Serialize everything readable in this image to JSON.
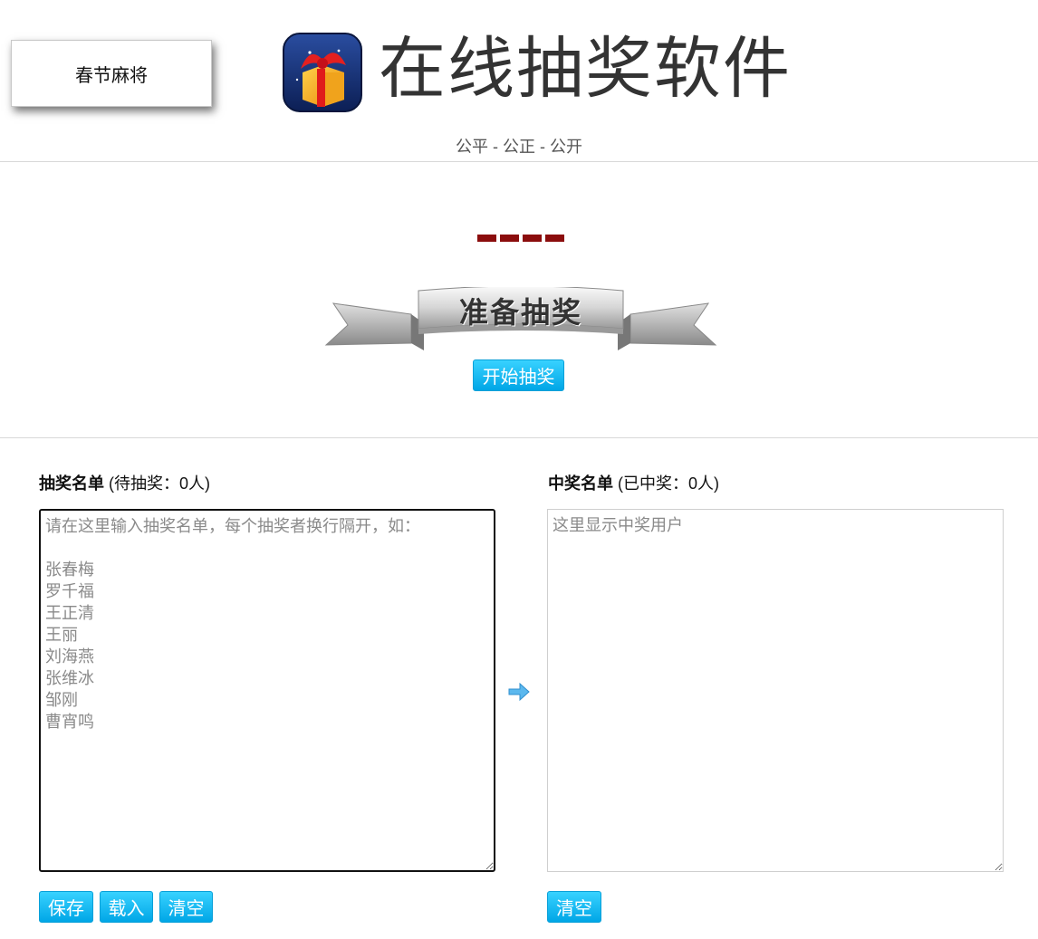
{
  "header": {
    "side_tag": "春节麻将",
    "title": "在线抽奖软件",
    "subtitle": "公平 - 公正 - 公开",
    "icon": "gift-box-icon"
  },
  "draw": {
    "banner_text": "准备抽奖",
    "start_button": "开始抽奖",
    "placeholder_dashes": 4,
    "dash_color": "#8b0d0d"
  },
  "left_panel": {
    "title": "抽奖名单",
    "count_text": "(待抽奖：0人)",
    "placeholder": "请在这里输入抽奖名单，每个抽奖者换行隔开，如：\n\n张春梅\n罗千福\n王正清\n王丽\n刘海燕\n张维冰\n邹刚\n曹宵鸣",
    "value": "",
    "buttons": {
      "save": "保存",
      "load": "载入",
      "clear": "清空"
    }
  },
  "transfer_icon": "arrow-right-icon",
  "right_panel": {
    "title": "中奖名单",
    "count_text": "(已中奖：0人)",
    "placeholder": "这里显示中奖用户",
    "value": "",
    "buttons": {
      "clear": "清空"
    }
  },
  "colors": {
    "button_top": "#38d2ff",
    "button_bottom": "#00a6e6",
    "accent_dash": "#8b0d0d"
  }
}
